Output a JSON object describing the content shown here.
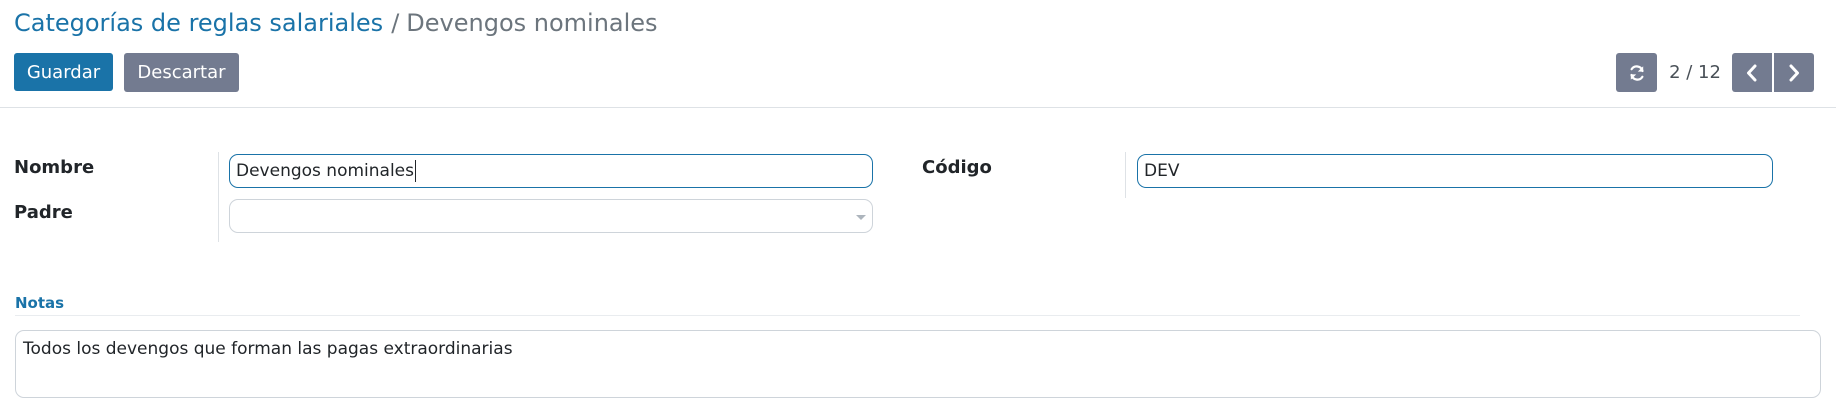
{
  "breadcrumb": {
    "parent": "Categorías de reglas salariales",
    "separator": "/",
    "current": "Devengos nominales"
  },
  "toolbar": {
    "save_label": "Guardar",
    "discard_label": "Descartar"
  },
  "pager": {
    "value": "2 / 12",
    "reload_icon": "refresh-icon",
    "prev_icon": "chevron-left-icon",
    "next_icon": "chevron-right-icon"
  },
  "form": {
    "name_label": "Nombre",
    "name_value": "Devengos nominales",
    "parent_label": "Padre",
    "parent_value": "",
    "code_label": "Código",
    "code_value": "DEV"
  },
  "notes": {
    "title": "Notas",
    "text": "Todos los devengos que forman las pagas extraordinarias"
  },
  "colors": {
    "primary": "#1a73a8",
    "secondary": "#737b90",
    "muted_text": "#6c757d"
  }
}
